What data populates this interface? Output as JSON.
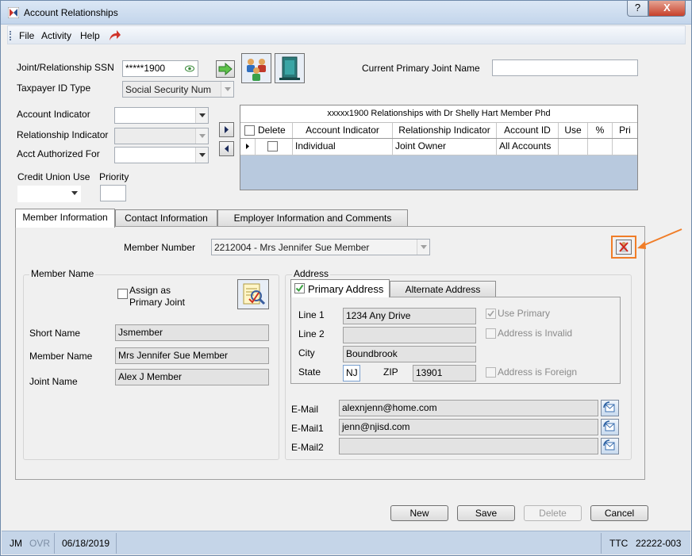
{
  "window": {
    "title": "Account Relationships",
    "help_label": "?",
    "close_label": "X"
  },
  "menu": {
    "items": [
      "File",
      "Activity",
      "Help"
    ]
  },
  "top_form": {
    "ssn_label": "Joint/Relationship SSN",
    "ssn_value": "*****1900",
    "taxpayer_label": "Taxpayer ID Type",
    "taxpayer_value": "Social Security Num",
    "current_primary_label": "Current Primary Joint Name",
    "current_primary_value": "",
    "account_indicator_label": "Account Indicator",
    "account_indicator_value": "",
    "relationship_indicator_label": "Relationship Indicator",
    "relationship_indicator_value": "",
    "acct_authorized_label": "Acct Authorized For",
    "acct_authorized_value": "",
    "credit_union_use_label": "Credit Union Use",
    "credit_union_use_value": "",
    "priority_label": "Priority",
    "priority_value": ""
  },
  "grid": {
    "caption": "xxxxx1900 Relationships with Dr Shelly Hart Member Phd",
    "columns": [
      "Delete",
      "Account Indicator",
      "Relationship Indicator",
      "Account ID",
      "Use",
      "%",
      "Pri"
    ],
    "rows": [
      {
        "account_indicator": "Individual",
        "relationship_indicator": "Joint Owner",
        "account_id": "All Accounts",
        "use": "",
        "pct": "",
        "pri": ""
      }
    ]
  },
  "tabs": [
    "Member Information",
    "Contact Information",
    "Employer Information and Comments"
  ],
  "member_info": {
    "member_number_label": "Member Number",
    "member_number_value": "2212004 - Mrs Jennifer Sue Member",
    "member_name_group": "Member Name",
    "assign_primary_label_1": "Assign as",
    "assign_primary_label_2": "Primary Joint",
    "short_name_label": "Short Name",
    "short_name_value": "Jsmember",
    "member_name_label": "Member Name",
    "member_name_value": "Mrs Jennifer Sue Member",
    "joint_name_label": "Joint Name",
    "joint_name_value": "Alex J Member"
  },
  "address": {
    "group_label": "Address",
    "tab_primary": "Primary Address",
    "tab_alternate": "Alternate Address",
    "line1_label": "Line 1",
    "line1_value": "1234 Any Drive",
    "line2_label": "Line 2",
    "line2_value": "",
    "city_label": "City",
    "city_value": "Boundbrook",
    "state_label": "State",
    "state_value": "NJ",
    "zip_label": "ZIP",
    "zip_value": "13901",
    "use_primary_label": "Use Primary",
    "address_invalid_label": "Address is Invalid",
    "address_foreign_label": "Address is Foreign",
    "email_label": "E-Mail",
    "email_value": "alexnjenn@home.com",
    "email1_label": "E-Mail1",
    "email1_value": "jenn@njisd.com",
    "email2_label": "E-Mail2",
    "email2_value": ""
  },
  "buttons": {
    "new": "New",
    "save": "Save",
    "delete": "Delete",
    "cancel": "Cancel"
  },
  "status_bar": {
    "user": "JM",
    "mode": "OVR",
    "date": "06/18/2019",
    "site": "TTC",
    "code": "22222-003"
  },
  "colors": {
    "highlight": "#f07d28",
    "status_bar": "#c5d5e8",
    "grid_bg": "#b8c9de"
  }
}
